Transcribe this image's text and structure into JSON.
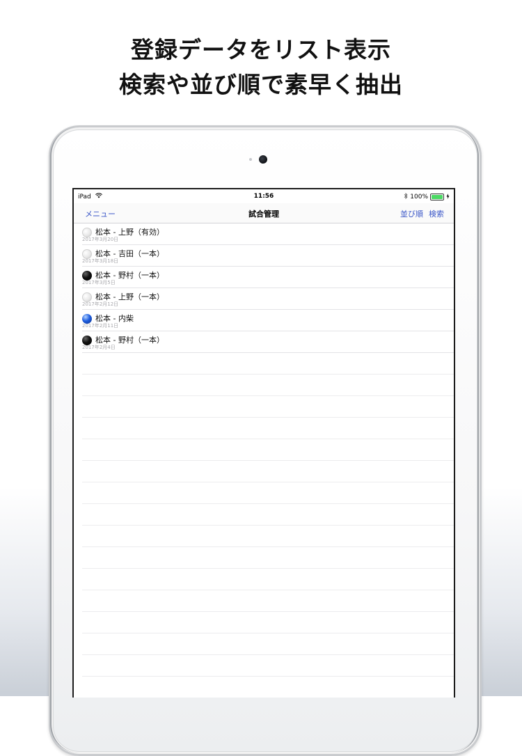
{
  "headline": {
    "line1": "登録データをリスト表示",
    "line2": "検索や並び順で素早く抽出"
  },
  "statusbar": {
    "carrier": "iPad",
    "time": "11:56",
    "battery": "100%",
    "battery_level": 1.0
  },
  "navbar": {
    "menu": "メニュー",
    "title": "試合管理",
    "sort": "並び順",
    "search": "検索"
  },
  "matches": [
    {
      "title": "松本 - 上野（有効）",
      "date": "2017年3月20日",
      "dot": "white"
    },
    {
      "title": "松本 - 吉田（一本）",
      "date": "2017年3月18日",
      "dot": "white"
    },
    {
      "title": "松本 - 野村（一本）",
      "date": "2017年3月5日",
      "dot": "black"
    },
    {
      "title": "松本 - 上野（一本）",
      "date": "2017年2月12日",
      "dot": "white"
    },
    {
      "title": "松本 - 内柴",
      "date": "2017年2月11日",
      "dot": "blue"
    },
    {
      "title": "松本 - 野村（一本）",
      "date": "2017年2月4日",
      "dot": "black"
    }
  ],
  "colors": {
    "accent": "#3b57c8",
    "battery_fill": "#4cd964"
  },
  "icons": {
    "wifi": "wifi-icon",
    "bluetooth": "bluetooth-icon",
    "charging": "charging-icon"
  }
}
